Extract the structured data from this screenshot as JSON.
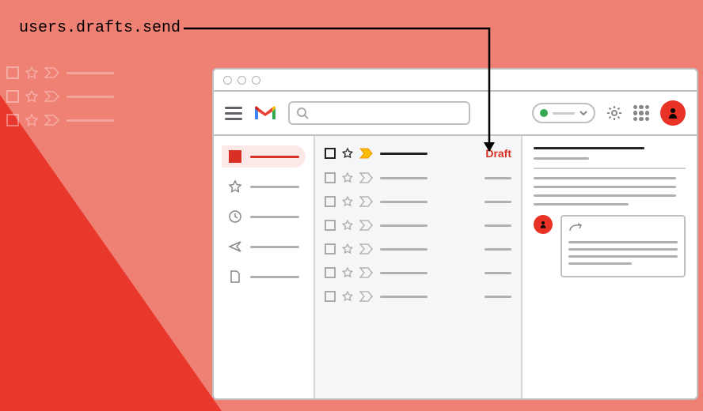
{
  "api_call": "users.drafts.send",
  "draft_badge": "Draft",
  "nav": {
    "inbox": "inbox-icon",
    "starred": "star-icon",
    "snoozed": "clock-icon",
    "sent": "send-icon",
    "drafts": "file-icon"
  },
  "message_rows": 7,
  "colors": {
    "accent": "#d93025",
    "bg": "#ef8074"
  }
}
